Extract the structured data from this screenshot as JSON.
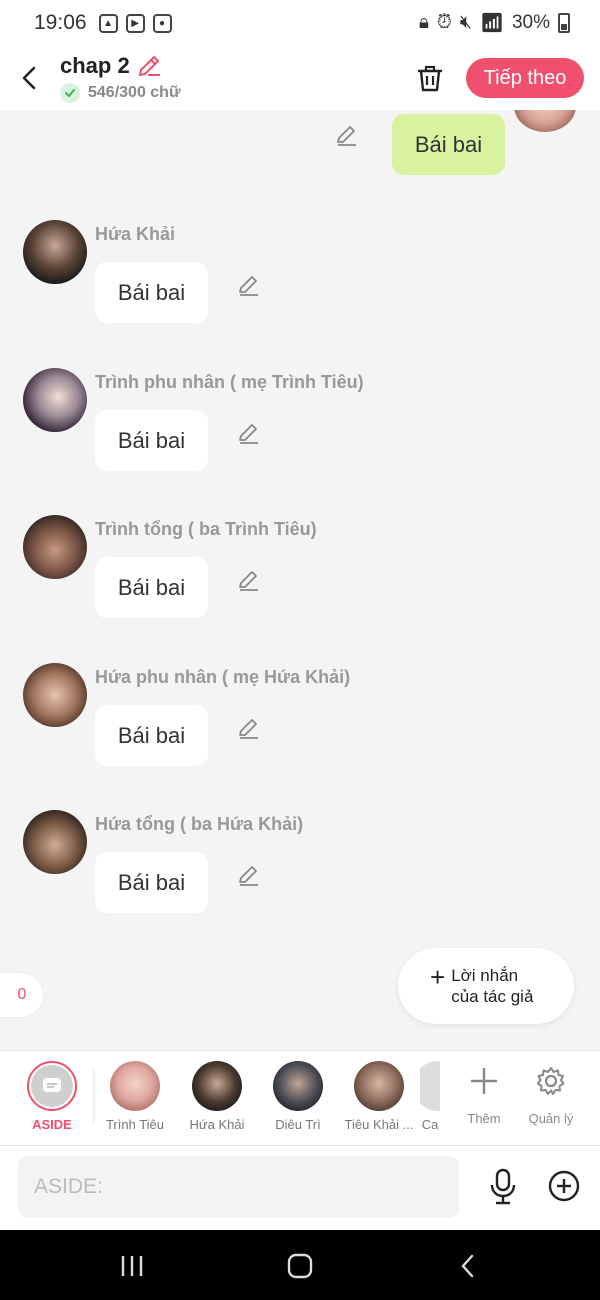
{
  "status_bar": {
    "time": "19:06",
    "battery": "30%"
  },
  "header": {
    "title": "chap 2",
    "word_count": "546/300 chữ",
    "next_label": "Tiếp theo"
  },
  "chat": {
    "self_message": "Bái bai",
    "messages": [
      {
        "name": "Hứa Khải",
        "text": "Bái bai"
      },
      {
        "name": "Trình phu nhân ( mẹ Trình Tiêu)",
        "text": "Bái bai"
      },
      {
        "name": "Trình tổng ( ba Trình Tiêu)",
        "text": "Bái bai"
      },
      {
        "name": "Hứa phu nhân ( mẹ Hứa Khải)",
        "text": "Bái bai"
      },
      {
        "name": "Hứa tổng ( ba Hứa Khải)",
        "text": "Bái bai"
      }
    ],
    "left_counter": "0",
    "author_note_line1": "Lời nhắn",
    "author_note_line2": "của tác giả"
  },
  "characters": {
    "aside": "ASIDE",
    "items": [
      "Trình Tiêu",
      "Hứa Khải",
      "Diêu Trì",
      "Tiêu Khải ..."
    ],
    "partial": "Ca",
    "add_label": "Thêm",
    "manage_label": "Quản lý"
  },
  "input": {
    "placeholder": "ASIDE:"
  },
  "colors": {
    "accent": "#f0506e",
    "self_bubble": "#d8f2a0",
    "background": "#f4f4f4"
  },
  "icons": [
    "back-arrow-icon",
    "pencil-icon",
    "check-icon",
    "trash-icon",
    "mic-icon",
    "plus-circle-icon",
    "gear-icon",
    "plus-icon",
    "chat-bubble-icon"
  ]
}
